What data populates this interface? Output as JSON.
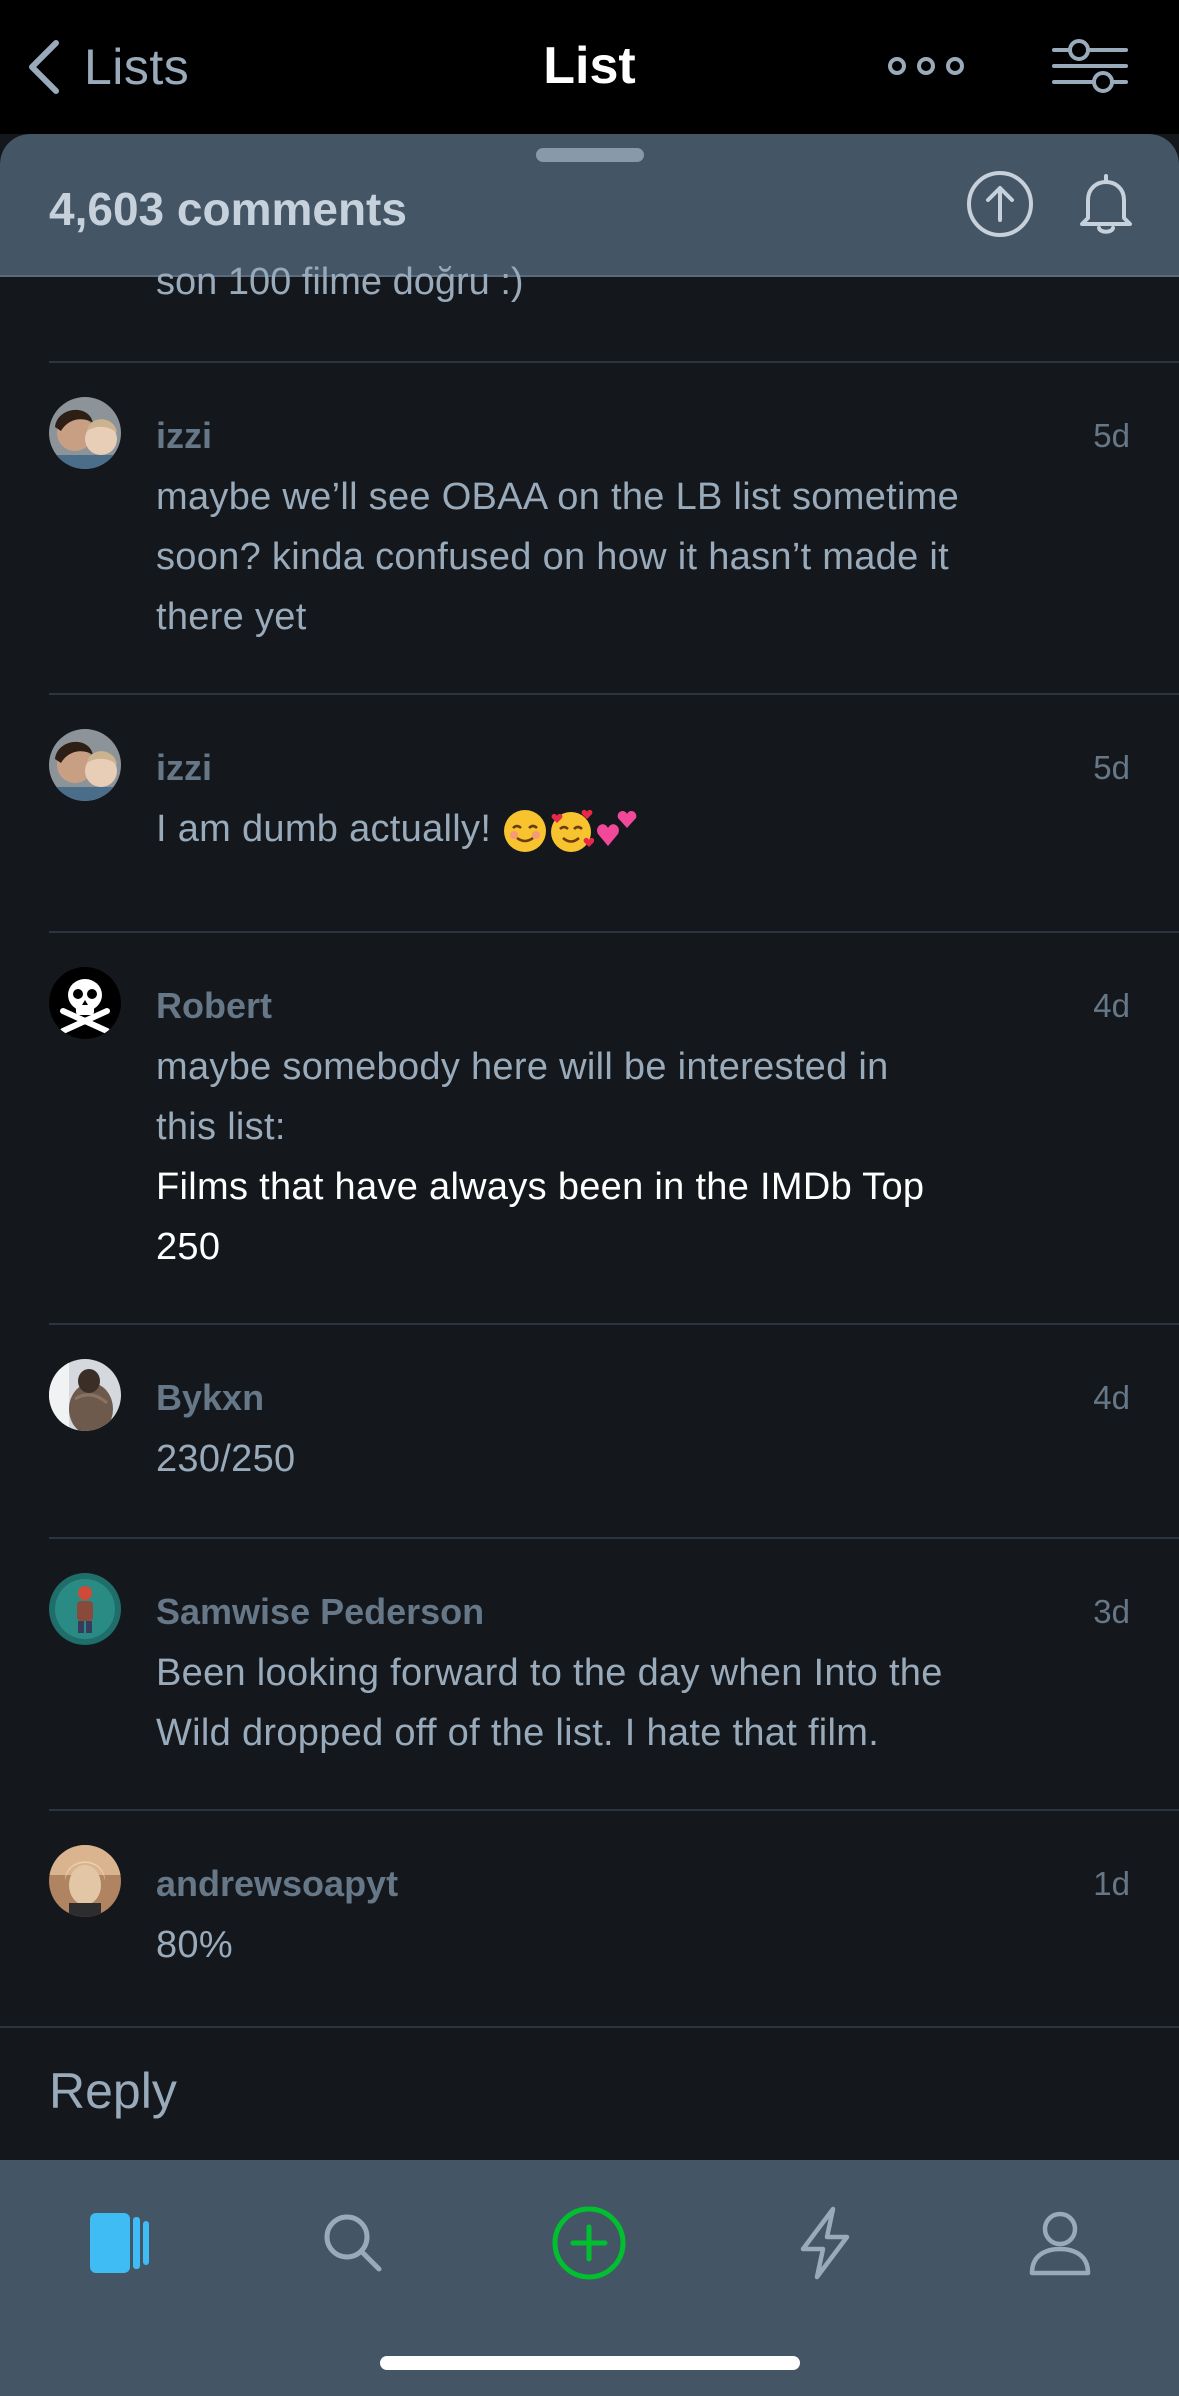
{
  "nav": {
    "back_label": "Lists",
    "title": "List"
  },
  "sheet": {
    "comment_count": "4,603 comments"
  },
  "partial_comment": "son 100 filme doğru :)",
  "comments": [
    {
      "user": "izzi",
      "time": "5d",
      "lines": [
        "maybe we’ll see OBAA on the LB list sometime",
        "soon? kinda confused on how it hasn’t made it",
        "there yet"
      ]
    },
    {
      "user": "izzi",
      "time": "5d",
      "text": "I am dumb actually! ",
      "emojis": [
        "relieved-face",
        "smiling-face-with-hearts",
        "two-hearts"
      ]
    },
    {
      "user": "Robert",
      "time": "4d",
      "lines": [
        "maybe somebody here will be interested in",
        "this list:"
      ],
      "link_lines": [
        "Films that have always been in the IMDb Top",
        "250"
      ]
    },
    {
      "user": "Bykxn",
      "time": "4d",
      "lines": [
        "230/250"
      ]
    },
    {
      "user": "Samwise Pederson",
      "time": "3d",
      "lines": [
        "Been looking forward to the day when Into the",
        "Wild dropped off of the list. I hate that film."
      ]
    },
    {
      "user": "andrewsoapyt",
      "time": "1d",
      "lines": [
        "80%"
      ]
    }
  ],
  "reply": {
    "label": "Reply"
  },
  "tabbar": {
    "items": [
      "films-tab-icon",
      "search-icon",
      "add-entry-icon",
      "activity-icon",
      "profile-icon"
    ],
    "active": "films-tab-icon"
  },
  "colors": {
    "background": "#14181c",
    "header": "#445566",
    "accent_blue": "#40bcf4",
    "accent_green": "#00c030",
    "text_muted": "#99aabb"
  }
}
